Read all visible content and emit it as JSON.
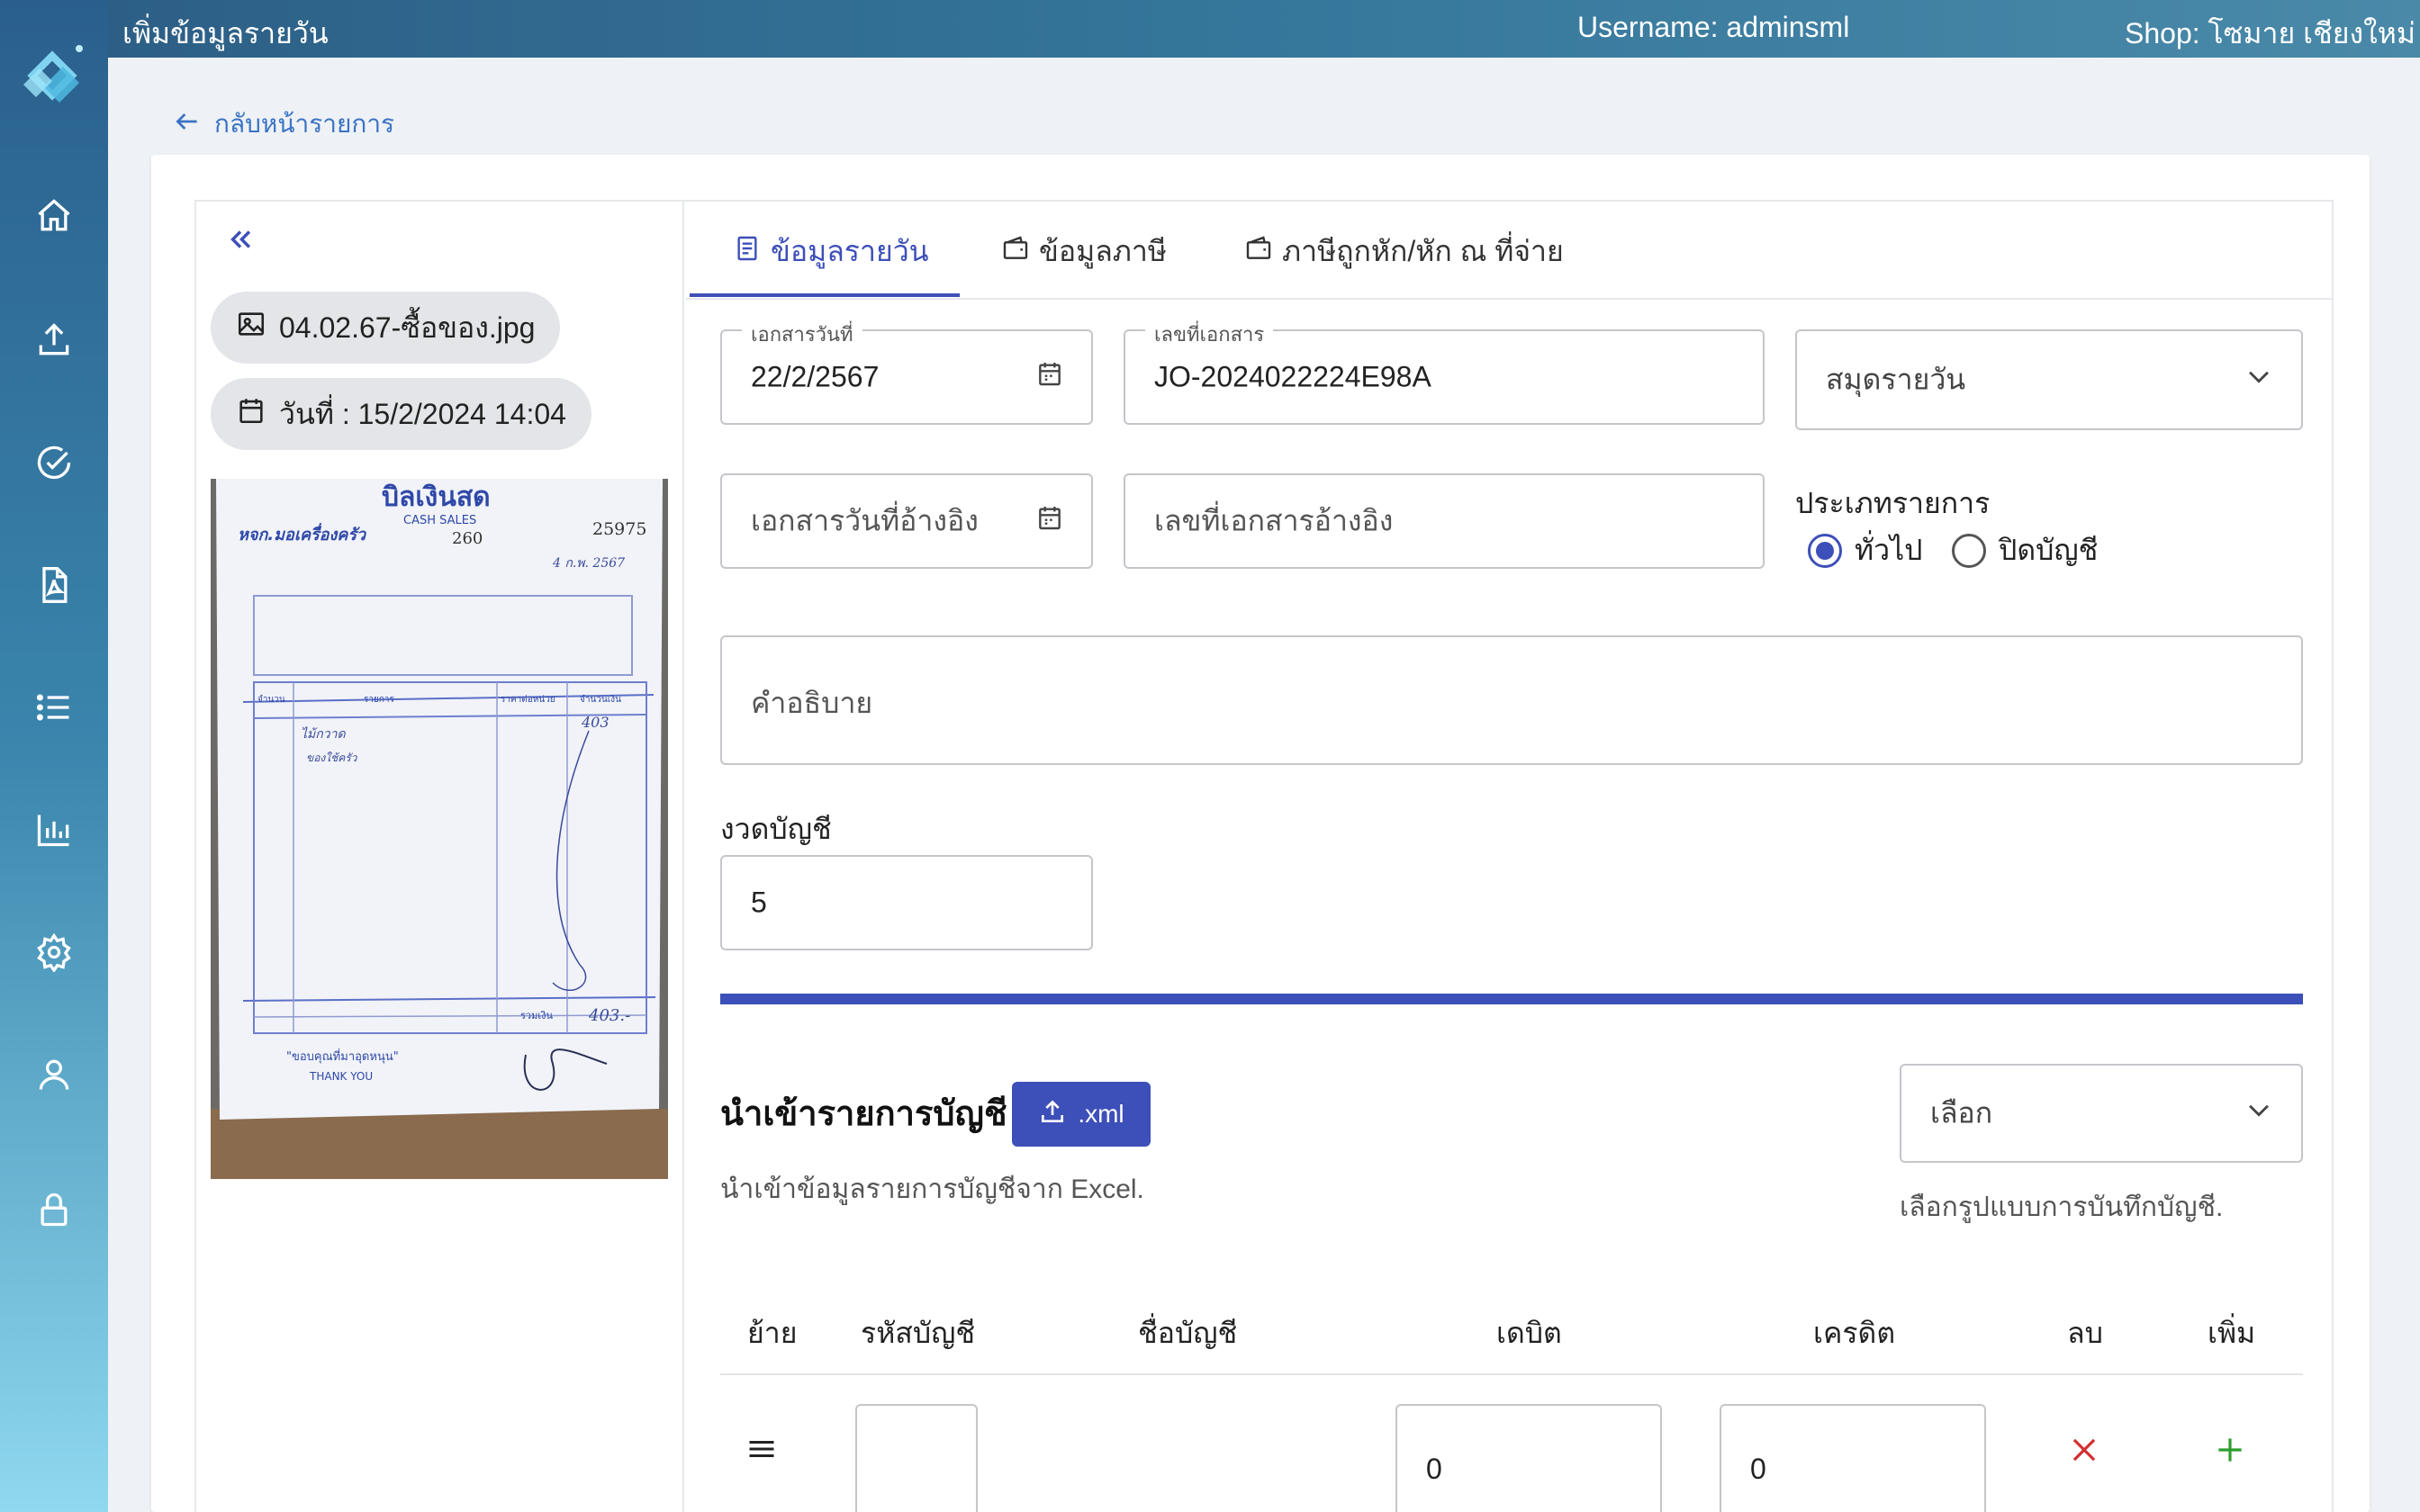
{
  "topbar": {
    "title": "เพิ่มข้อมูลรายวัน",
    "username": "Username: adminsml",
    "shop": "Shop: โซมาย เชียงใหม่"
  },
  "sidebar": {
    "items": [
      {
        "icon": "home-icon"
      },
      {
        "icon": "upload-icon"
      },
      {
        "icon": "check-circle-icon"
      },
      {
        "icon": "pdf-file-icon"
      },
      {
        "icon": "list-icon"
      },
      {
        "icon": "bar-chart-icon"
      },
      {
        "icon": "gear-icon"
      },
      {
        "icon": "user-icon"
      },
      {
        "icon": "lock-icon"
      }
    ]
  },
  "back_link": "กลับหน้ารายการ",
  "left_panel": {
    "file_name": "04.02.67-ซื้อของ.jpg",
    "date_label": "วันที่ : 15/2/2024 14:04",
    "receipt": {
      "title": "บิลเงินสด",
      "subtitle": "CASH SALES",
      "shop_name": "หจก.มอเครื่องครัว",
      "book_no": "260",
      "doc_no": "25975",
      "date": "4 ก.พ. 2567",
      "amount": "403",
      "total": "403.-",
      "item1": "ไม้กวาด",
      "item2": "ของใช้ครัว",
      "col_qty": "จำนวน",
      "col_desc": "รายการ",
      "col_price": "ราคาต่อหน่วย",
      "col_amount": "จำนวนเงิน",
      "total_label": "รวมเงิน",
      "thanks": "\"ขอบคุณที่มาอุดหนุน\"",
      "thank_you": "THANK YOU"
    }
  },
  "tabs": [
    {
      "label": "ข้อมูลรายวัน",
      "active": true
    },
    {
      "label": "ข้อมูลภาษี",
      "active": false
    },
    {
      "label": "ภาษีถูกหัก/หัก ณ ที่จ่าย",
      "active": false
    }
  ],
  "form": {
    "doc_date_label": "เอกสารวันที่",
    "doc_date_value": "22/2/2567",
    "doc_no_label": "เลขที่เอกสาร",
    "doc_no_value": "JO-2024022224E98A",
    "journal_select": "สมุดรายวัน",
    "ref_date_placeholder": "เอกสารวันที่อ้างอิง",
    "ref_no_placeholder": "เลขที่เอกสารอ้างอิง",
    "type_label": "ประเภทรายการ",
    "type_options": [
      "ทั่วไป",
      "ปิดบัญชี"
    ],
    "type_selected": "ทั่วไป",
    "description_placeholder": "คำอธิบาย",
    "period_label": "งวดบัญชี",
    "period_value": "5"
  },
  "import": {
    "title": "นำเข้ารายการบัญชี",
    "button": ".xml",
    "subtitle": "นำเข้าข้อมูลรายการบัญชีจาก Excel.",
    "format_select": "เลือก",
    "format_hint": "เลือกรูปแบบการบันทึกบัญชี."
  },
  "table": {
    "headers": [
      "ย้าย",
      "รหัสบัญชี",
      "ชื่อบัญชี",
      "เดบิต",
      "เครดิต",
      "ลบ",
      "เพิ่ม"
    ],
    "rows": [
      {
        "account_code": "",
        "account_name": "",
        "debit": "0",
        "credit": "0"
      }
    ]
  },
  "colors": {
    "primary": "#3d4fb8",
    "delete": "#d32f2f",
    "add": "#2e9e2e"
  }
}
